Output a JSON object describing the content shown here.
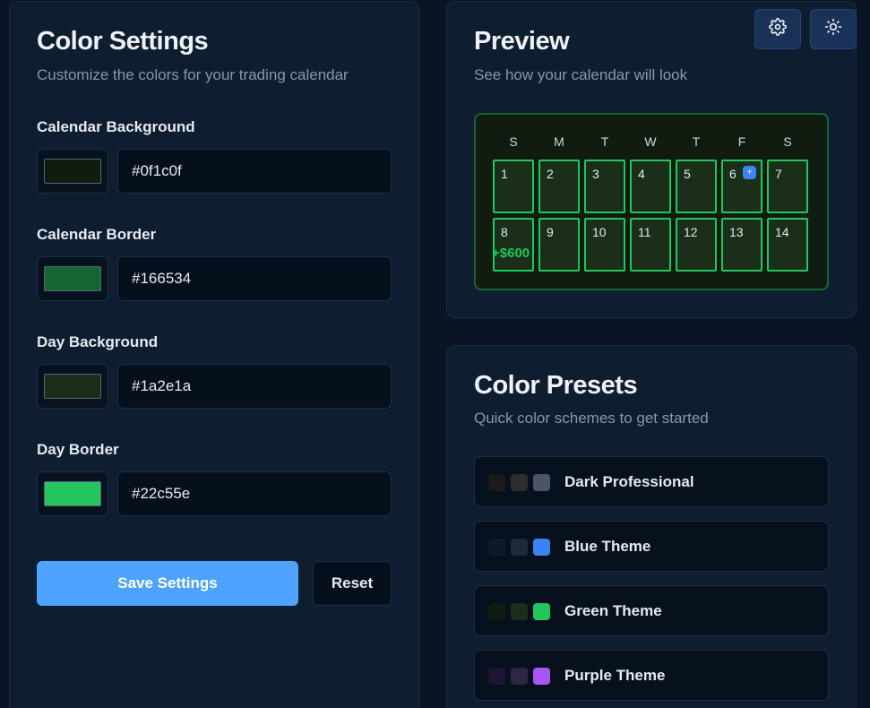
{
  "settings": {
    "title": "Color Settings",
    "subtitle": "Customize the colors for your trading calendar",
    "fields": [
      {
        "label": "Calendar Background",
        "value": "#0f1c0f",
        "color": "#0f1c0f"
      },
      {
        "label": "Calendar Border",
        "value": "#166534",
        "color": "#166534"
      },
      {
        "label": "Day Background",
        "value": "#1a2e1a",
        "color": "#1a2e1a"
      },
      {
        "label": "Day Border",
        "value": "#22c55e",
        "color": "#22c55e"
      }
    ],
    "save_label": "Save Settings",
    "reset_label": "Reset"
  },
  "preview": {
    "title": "Preview",
    "subtitle": "See how your calendar will look",
    "weekdays": [
      "S",
      "M",
      "T",
      "W",
      "T",
      "F",
      "S"
    ],
    "days": [
      "1",
      "2",
      "3",
      "4",
      "5",
      "6",
      "7",
      "8",
      "9",
      "10",
      "11",
      "12",
      "13",
      "14"
    ],
    "add_badge": "+",
    "pnl_label": "+$600"
  },
  "presets": {
    "title": "Color Presets",
    "subtitle": "Quick color schemes to get started",
    "items": [
      {
        "label": "Dark Professional",
        "colors": [
          "#1a1a1a",
          "#2d2d2d",
          "#4b5563"
        ]
      },
      {
        "label": "Blue Theme",
        "colors": [
          "#0f172a",
          "#1e293b",
          "#3b82f6"
        ]
      },
      {
        "label": "Green Theme",
        "colors": [
          "#0f1c0f",
          "#1a2e1a",
          "#22c55e"
        ]
      },
      {
        "label": "Purple Theme",
        "colors": [
          "#1e1533",
          "#2d2644",
          "#a855f7"
        ]
      }
    ]
  },
  "toolbar": {
    "settings_icon": "gear-icon",
    "theme_icon": "sun-icon"
  }
}
